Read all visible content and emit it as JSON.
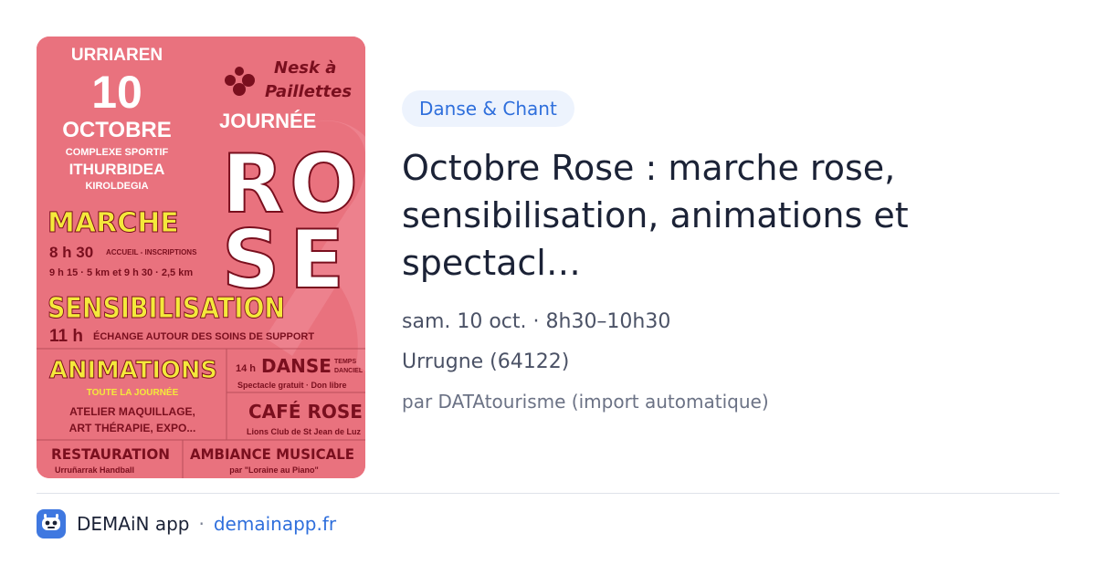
{
  "poster": {
    "top_left": {
      "urriaren": "URRIAREN",
      "day": "10",
      "month": "OCTOBRE",
      "venue1": "COMPLEXE SPORTIF",
      "venue2": "ITHURBIDEA",
      "venue3": "KIROLDEGIA"
    },
    "brand": {
      "line1": "Nesk à",
      "line2": "Paillettes"
    },
    "journee": "JOURNÉE",
    "rose": {
      "r": "R",
      "o": "O",
      "s": "S",
      "e": "E"
    },
    "marche": {
      "title": "MARCHE",
      "time1": "8 h 30",
      "time1_note": "ACCUEIL - INSCRIPTIONS",
      "time2": "9 h 15 · 5 km et 9 h 30 · 2,5 km"
    },
    "sensibilisation": {
      "title": "SENSIBILISATION",
      "time": "11 h",
      "text": "ÉCHANGE AUTOUR DES SOINS DE SUPPORT"
    },
    "animations": {
      "title": "ANIMATIONS",
      "sub": "TOUTE LA JOURNÉE",
      "line1": "ATELIER MAQUILLAGE,",
      "line2": "ART THÉRAPIE, EXPO..."
    },
    "danse": {
      "time": "14 h",
      "title": "DANSE",
      "note1": "TEMPS",
      "note2": "DANCIEL",
      "sub": "Spectacle gratuit · Don libre"
    },
    "cafe": {
      "title": "CAFÉ ROSE",
      "sub": "Lions Club de St Jean de Luz"
    },
    "restauration": {
      "title": "RESTAURATION",
      "sub": "Urruñarrak Handball"
    },
    "ambiance": {
      "title": "AMBIANCE MUSICALE",
      "sub": "par \"Loraine au Piano\""
    }
  },
  "event": {
    "category": "Danse & Chant",
    "title": "Octobre Rose : marche rose, sensibilisation, animations et spectacl…",
    "date": "sam. 10 oct. · 8h30–10h30",
    "location": "Urrugne (64122)",
    "source": "par DATAtourisme (import automatique)"
  },
  "footer": {
    "app_name": "DEMAiN app",
    "separator": "·",
    "link": "demainapp.fr"
  },
  "colors": {
    "poster_bg": "#e9727e",
    "yellow": "#f4e93b",
    "dark_red": "#7a0f1e",
    "accent_blue": "#2f6fdc"
  }
}
